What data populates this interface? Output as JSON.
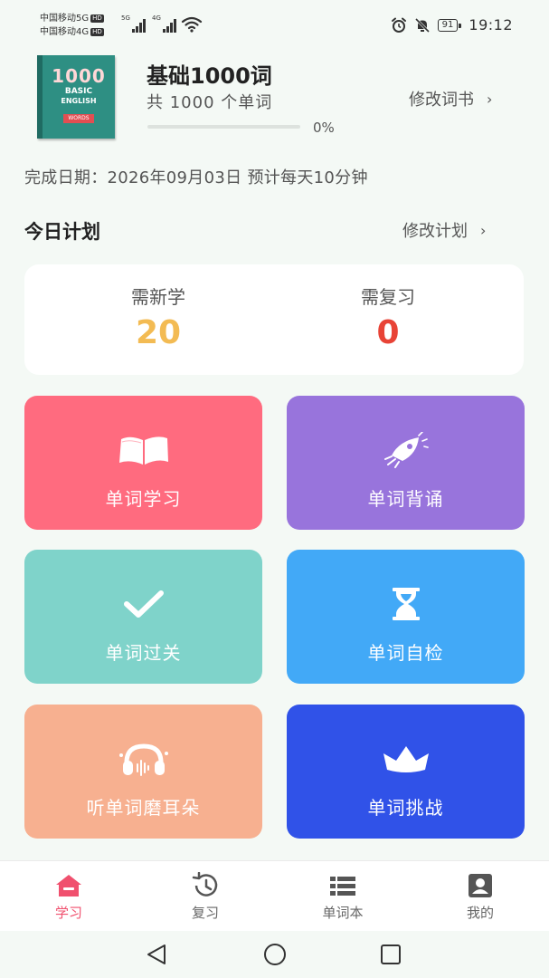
{
  "status_bar": {
    "carrier_1": "中国移动5G",
    "carrier_2": "中国移动4G",
    "hd_tag": "HD",
    "signal_1_tag": "5G",
    "signal_2_tag": "4G",
    "battery": "91",
    "time": "19:12"
  },
  "book": {
    "cover_number": "1000",
    "cover_line1": "BASIC",
    "cover_line2": "ENGLISH",
    "cover_tag": "WORDS",
    "title": "基础1000词",
    "count_text": "共 1000 个单词",
    "progress_percent": 0,
    "progress_text": "0%",
    "change_book_label": "修改词书"
  },
  "completion": {
    "text": "完成日期：2026年09月03日   预计每天10分钟"
  },
  "plan": {
    "title": "今日计划",
    "change_plan_label": "修改计划",
    "new_label": "需新学",
    "new_value": "20",
    "review_label": "需复习",
    "review_value": "0"
  },
  "tiles": [
    {
      "label": "单词学习",
      "icon": "open-book-icon",
      "color": "#ff6b7f"
    },
    {
      "label": "单词背诵",
      "icon": "rocket-icon",
      "color": "#9874dc"
    },
    {
      "label": "单词过关",
      "icon": "checkmark-icon",
      "color": "#7fd3ca"
    },
    {
      "label": "单词自检",
      "icon": "hourglass-icon",
      "color": "#42a9f7"
    },
    {
      "label": "听单词磨耳朵",
      "icon": "headphones-icon",
      "color": "#f7b090"
    },
    {
      "label": "单词挑战",
      "icon": "crown-icon",
      "color": "#3052e8"
    }
  ],
  "tabbar": {
    "items": [
      {
        "label": "学习",
        "icon": "home-icon",
        "active": true
      },
      {
        "label": "复习",
        "icon": "history-icon",
        "active": false
      },
      {
        "label": "单词本",
        "icon": "list-icon",
        "active": false
      },
      {
        "label": "我的",
        "icon": "profile-icon",
        "active": false
      }
    ],
    "active_color": "#f0506e"
  }
}
